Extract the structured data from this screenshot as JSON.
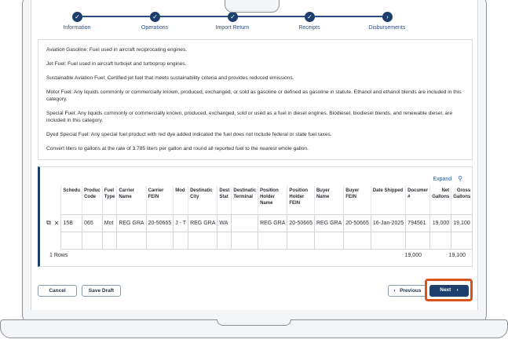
{
  "stepper": {
    "steps": [
      {
        "label": "Information",
        "icon": "check-icon"
      },
      {
        "label": "Operations",
        "icon": "check-icon"
      },
      {
        "label": "Import Return",
        "icon": "check-icon"
      },
      {
        "label": "Receipts",
        "icon": "check-icon"
      },
      {
        "label": "Disbursements",
        "icon": "chevron-right-icon"
      }
    ],
    "accent": "#1d3f6e"
  },
  "definitions": [
    "Aviation Gasoline: Fuel used in aircraft reciprocating engines.",
    "Jet Fuel: Fuel used in aircraft turbojet and turboprop engines.",
    "Sustainable Aviation Fuel: Certified jet fuel that meets sustainability criteria and provides reduced emissions.",
    "Motor Fuel: Any liquids commonly or commercially known, produced, exchanged, or sold as gasoline or defined as gasoline in statute. Ethanol and ethanol blends are included in this category.",
    "Special Fuel: Any liquids commonly or commercially known, produced, exchanged, sold or used as a fuel in diesel engines. Biodiesel, biodiesel blends, and renewable diesel, are included in this category.",
    "Dyed Special Fuel: Any special fuel product with red dye added indicated the fuel does not include federal or state fuel taxes.",
    "Convert liters to gallons at the rate of 3.785 liters per gallon and round all reported fuel to the nearest whole gallon."
  ],
  "table": {
    "expand_label": "Expand",
    "columns": [
      "Schedu",
      "Produc Code",
      "Fuel Type",
      "Carrier Name",
      "Carrier FEIN",
      "Mod",
      "Destinatic City",
      "Dest Stat",
      "Destinatic Terminal",
      "Position Holder Name",
      "Position Holder FEIN",
      "Buyer Name",
      "Buyer FEIN",
      "Date Shipped",
      "Documer #",
      "Net Gallons",
      "Gross Gallons"
    ],
    "rows": [
      [
        "15B",
        "065",
        "Mot",
        "REG GRA",
        "20-50665",
        "J - T",
        "REG GRA",
        "WA",
        "",
        "REG GRA",
        "20-50665",
        "REG GRA",
        "20-50665",
        "16-Jan-2025",
        "794561",
        "19,000",
        "19,100"
      ]
    ],
    "row_count": "1 Rows",
    "total_net": "19,000",
    "total_gross": "19,100"
  },
  "footer": {
    "cancel": "Cancel",
    "save_draft": "Save Draft",
    "previous": "Previous",
    "next": "Next",
    "highlight_color": "#d9531e"
  }
}
